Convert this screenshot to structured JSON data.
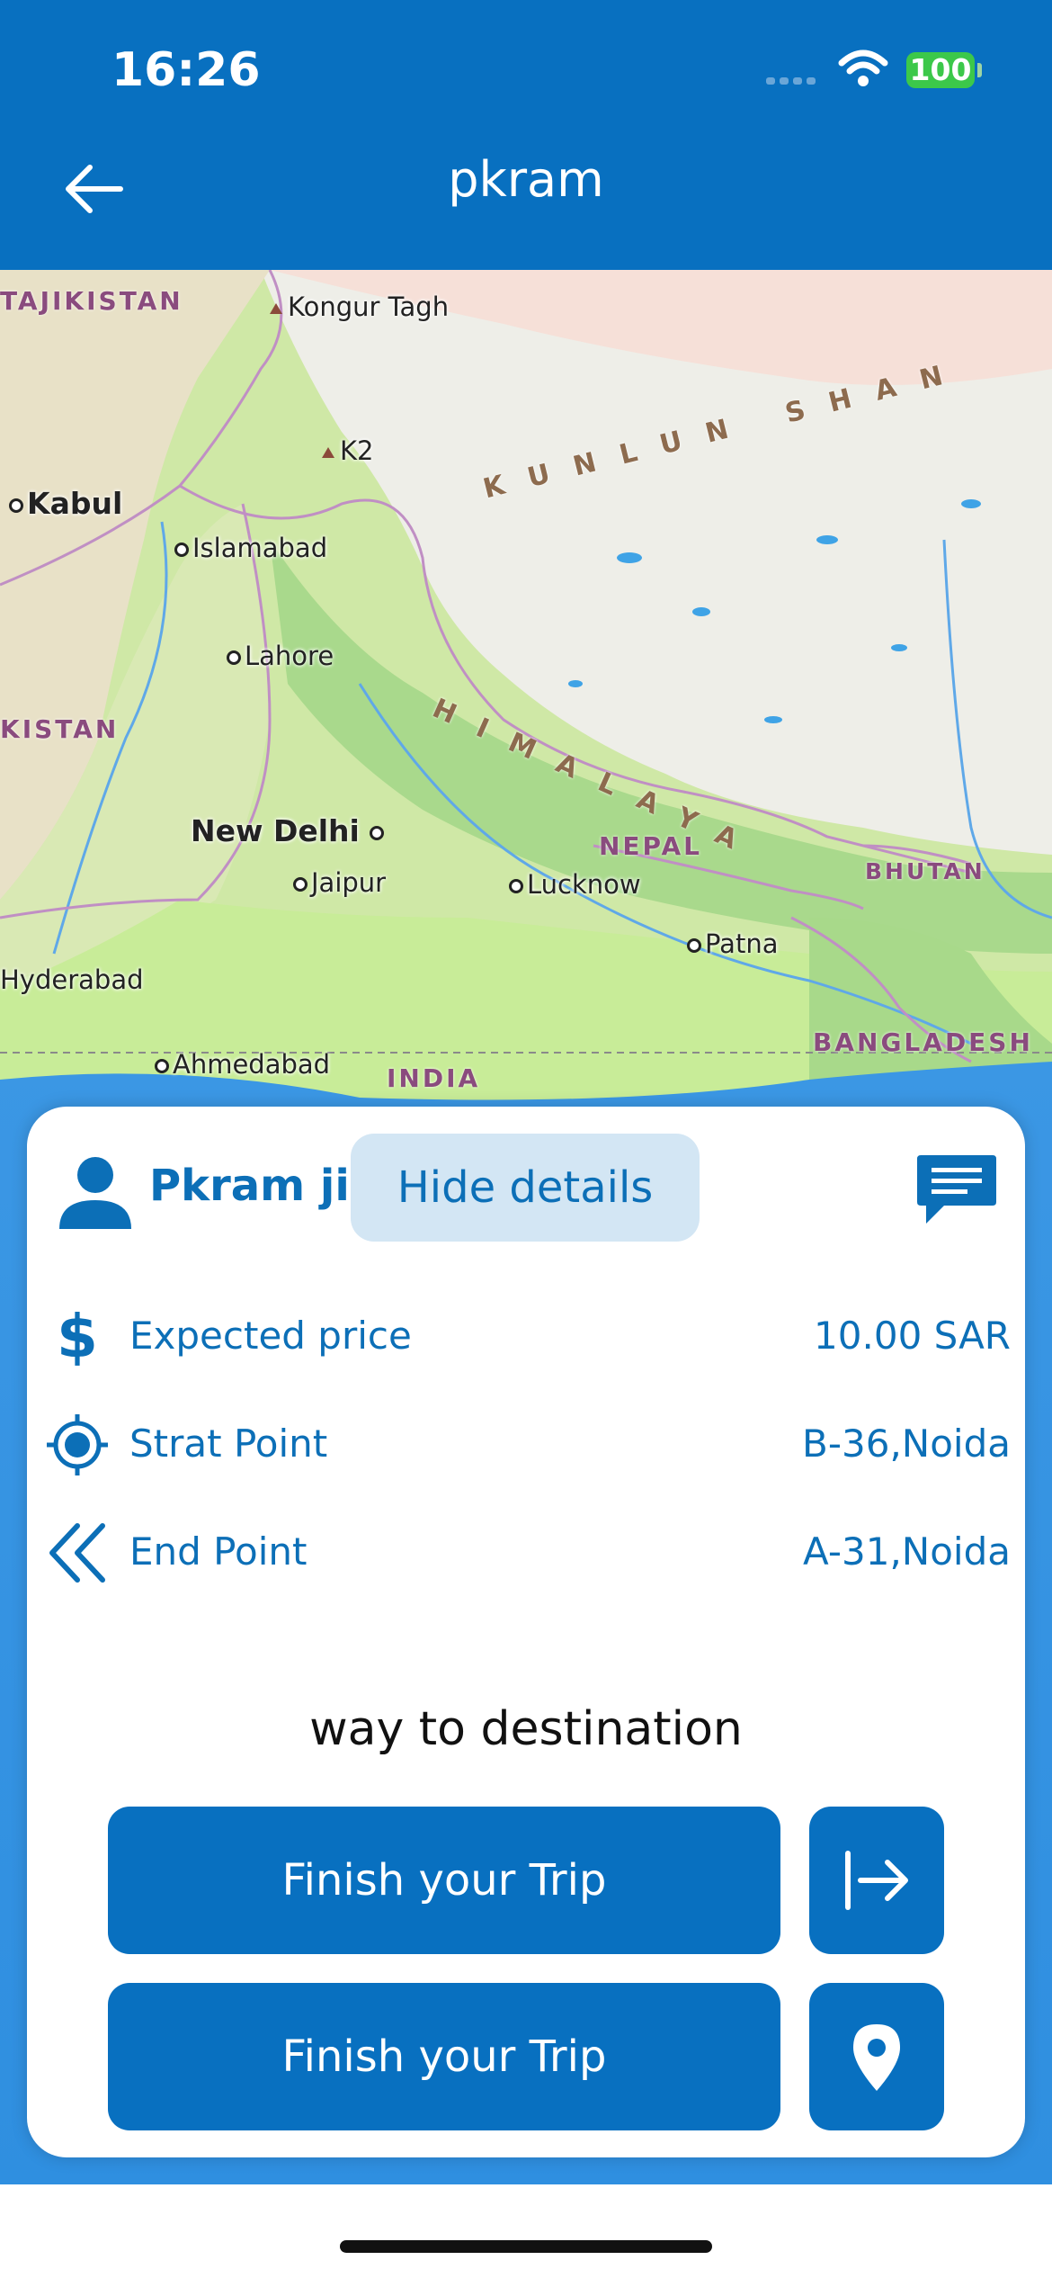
{
  "status_bar": {
    "time": "16:26",
    "battery": "100"
  },
  "nav": {
    "title": "pkram",
    "back_icon": "arrow-left-icon"
  },
  "map": {
    "labels": {
      "tajikistan": "TAJIKISTAN",
      "kongur": "Kongur Tagh",
      "kunlun": "KUNLUN SHAN",
      "k2": "K2",
      "kabul": "Kabul",
      "islamabad": "Islamabad",
      "lahore": "Lahore",
      "kistan": "KISTAN",
      "himalaya": "HIMALAYA",
      "new_delhi": "New Delhi",
      "nepal": "NEPAL",
      "bhutan": "BHUTAN",
      "jaipur": "Jaipur",
      "lucknow": "Lucknow",
      "patna": "Patna",
      "hyderabad": "Hyderabad",
      "bangladesh": "BANGLADESH",
      "ahmedabad": "Ahmedabad",
      "india": "INDIA"
    }
  },
  "card": {
    "user_name": "Pkram ji",
    "hide_details_label": "Hide details",
    "rows": [
      {
        "icon": "dollar-icon",
        "label": "Expected price",
        "value": "10.00 SAR"
      },
      {
        "icon": "crosshair-icon",
        "label": "Strat Point",
        "value": "B-36,Noida"
      },
      {
        "icon": "double-chevron-left-icon",
        "label": "End Point",
        "value": "A-31,Noida"
      }
    ],
    "way_title": "way to destination",
    "buttons": [
      {
        "label": "Finish your Trip",
        "icon": "exit-arrow-icon"
      },
      {
        "label": "Finish your Trip",
        "icon": "location-pin-icon"
      }
    ]
  },
  "colors": {
    "primary": "#0870c0",
    "light_button": "#d3e6f4",
    "text_blue": "#0c6fb7"
  }
}
